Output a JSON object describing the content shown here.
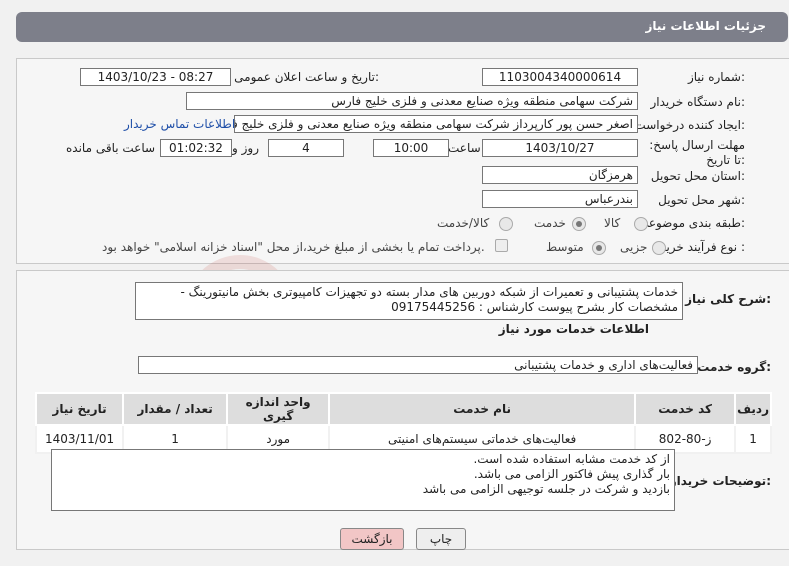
{
  "header": {
    "title": "جزئیات اطلاعات نیاز"
  },
  "labels": {
    "need_number": "شماره نیاز:",
    "announce_datetime": "تاریخ و ساعت اعلان عمومی:",
    "buyer_org": "نام دستگاه خریدار:",
    "requester": "ایجاد کننده درخواست:",
    "deadline": "مهلت ارسال پاسخ: تا تاریخ:",
    "time_word": "ساعت",
    "day_word": "روز و",
    "remaining": "ساعت باقی مانده",
    "province": "استان محل تحویل:",
    "city": "شهر محل تحویل:",
    "category": "طبقه بندی موضوعی:",
    "process_type": "نوع فرآیند خرید :",
    "summary": "شرح کلی نیاز:",
    "services_info": "اطلاعات خدمات مورد نیاز",
    "service_group": "گروه خدمت:",
    "buyer_notes": "توضیحات خریدار:"
  },
  "values": {
    "need_number": "1103004340000614",
    "announce_datetime": "1403/10/23 - 08:27",
    "buyer_org": "شرکت سهامی منطقه ویژه صنایع معدنی و فلزی خلیج فارس",
    "requester": "اصغر حسن پور کارپرداز شرکت سهامی منطقه ویژه صنایع معدنی و فلزی خلیج فارس",
    "contact_link": "اطلاعات تماس خریدار",
    "deadline_date": "1403/10/27",
    "deadline_time": "10:00",
    "days": "4",
    "remaining_time": "01:02:32",
    "province": "هرمزگان",
    "city": "بندرعباس",
    "summary_line1": "خدمات پشتیبانی و تعمیرات از شبکه دوربین های مدار بسته دو تجهیزات کامپیوتری بخش مانیتورینگ -",
    "summary_line2": "مشخصات کار بشرح پیوست  کارشناس :  09175445256",
    "service_group": "فعالیت‌های اداری و خدمات پشتیبانی",
    "notes_line1": "از کد خدمت مشابه استفاده شده است.",
    "notes_line2": "بار گذاری پیش فاکتور الزامی می باشد.",
    "notes_line3": "بازدید و شرکت در جلسه توجیهی الزامی می باشد"
  },
  "category_options": {
    "goods": "کالا",
    "service": "خدمت",
    "goods_service": "کالا/خدمت",
    "selected": "خدمت"
  },
  "process_options": {
    "minor": "جزیی",
    "medium": "متوسط",
    "selected": "متوسط",
    "payment_note": "پرداخت تمام یا بخشی از مبلغ خرید،از محل \"اسناد خزانه اسلامی\" خواهد بود."
  },
  "table": {
    "headers": [
      "ردیف",
      "کد خدمت",
      "نام خدمت",
      "واحد اندازه گیری",
      "تعداد / مقدار",
      "تاریخ نیاز"
    ],
    "rows": [
      [
        "1",
        "ز-80-802",
        "فعالیت‌های خدماتی سیستم‌های امنیتی",
        "مورد",
        "1",
        "1403/11/01"
      ]
    ]
  },
  "buttons": {
    "print": "چاپ",
    "back": "بازگشت"
  },
  "colors": {
    "header_bg": "#7d7f8a",
    "link": "#1f4fa8",
    "back_button": "#f2c6c6"
  }
}
